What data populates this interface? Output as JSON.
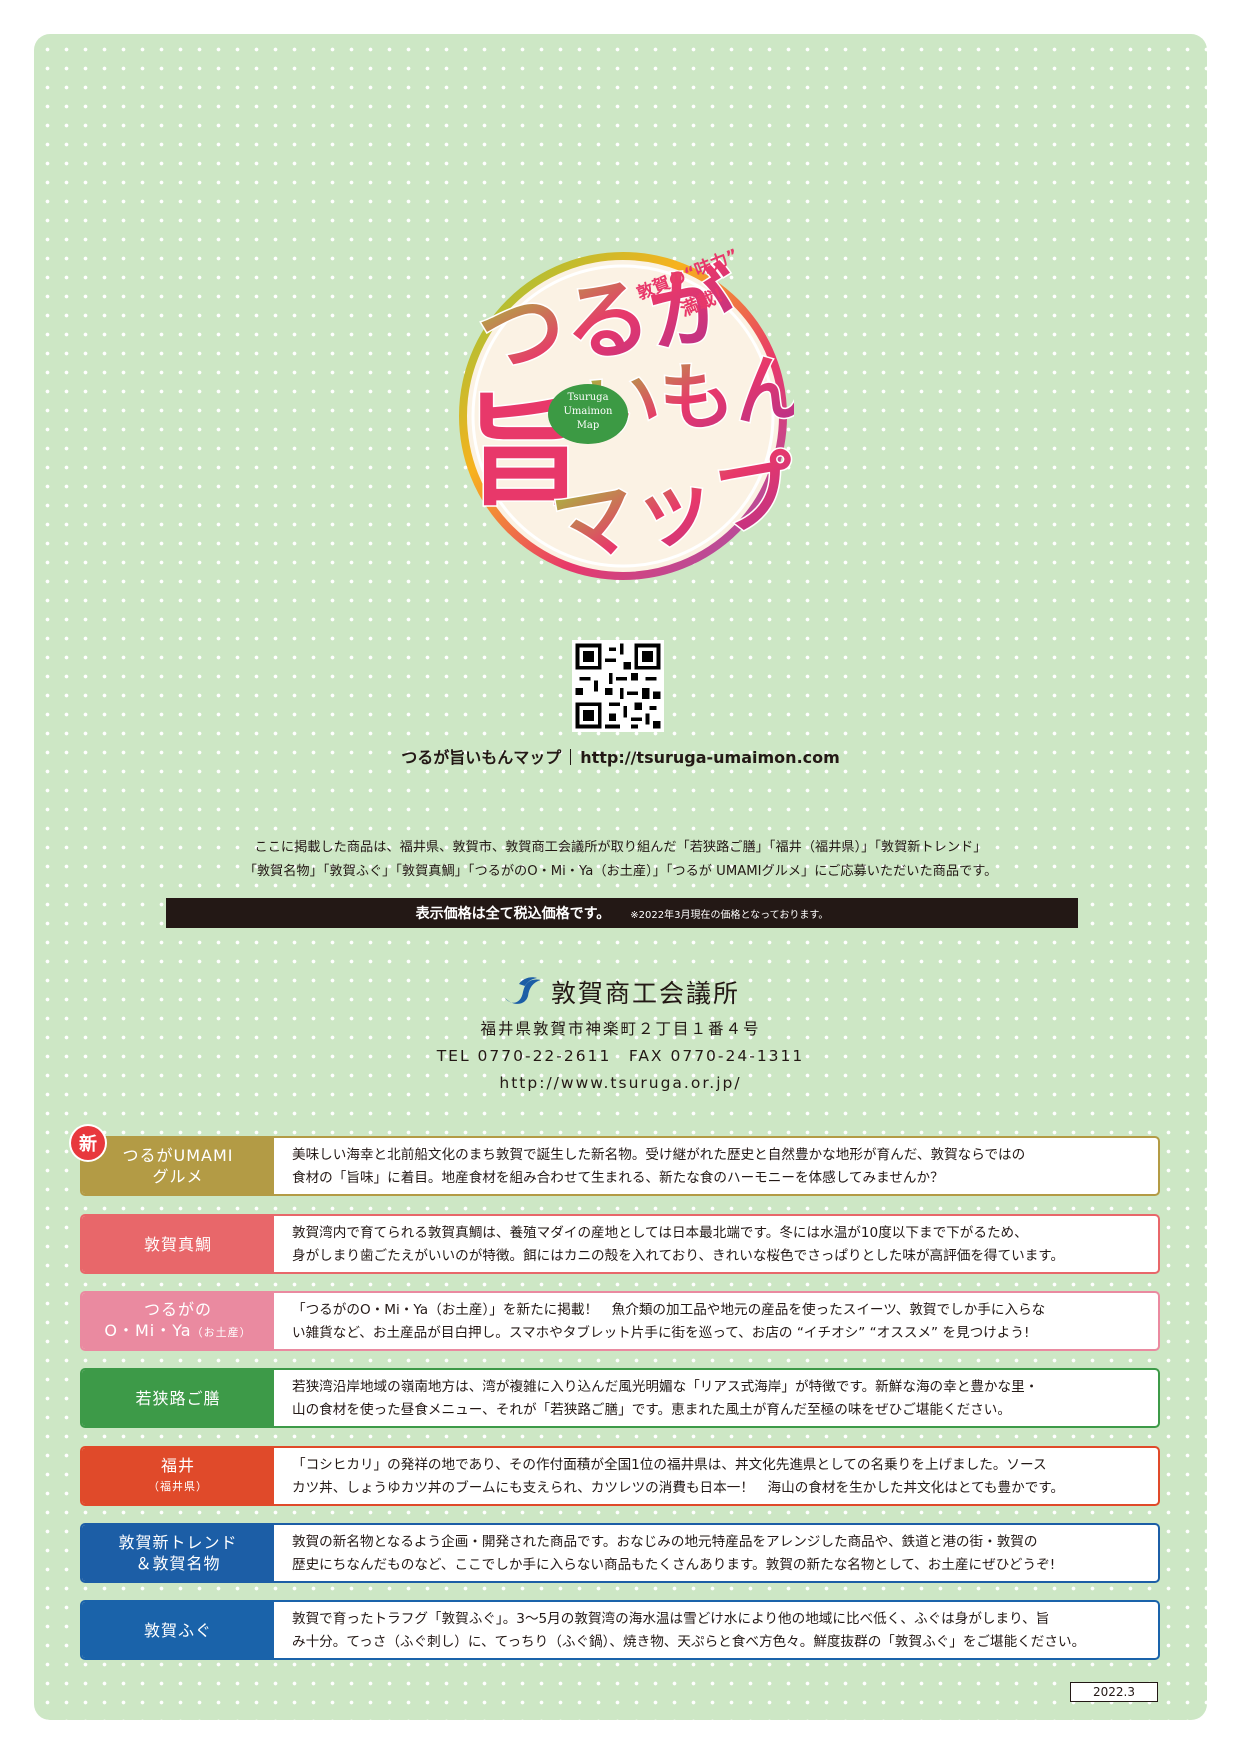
{
  "logo": {
    "title_line1": "つるが",
    "title_line2a": "旨",
    "title_line2b": "いもん",
    "title_line3": "マップ",
    "tagline_a": "敦賀の“味力”",
    "tagline_b": "満載！",
    "badge_line1": "Tsuruga",
    "badge_line2": "Umaimon",
    "badge_line3": "Map"
  },
  "website": {
    "name": "つるが旨いもんマップ",
    "url": "http://tsuruga-umaimon.com"
  },
  "intro": {
    "line1": "ここに掲載した商品は、福井県、敦賀市、敦賀商工会議所が取り組んだ「若狭路ご膳」「福井（福井県）」「敦賀新トレンド」",
    "line2": "「敦賀名物」「敦賀ふぐ」「敦賀真鯛」「つるがのO・Mi・Ya（お土産）」「つるが UMAMIグルメ」にご応募いただいた商品です。"
  },
  "tax_notice": {
    "main": "表示価格は全て税込価格です。",
    "note": "※2022年3月現在の価格となっております。"
  },
  "chamber": {
    "name": "敦賀商工会議所",
    "address": "福井県敦賀市神楽町２丁目１番４号",
    "tel_fax": "TEL 0770-22-2611　FAX 0770-24-1311",
    "url": "http://www.tsuruga.or.jp/"
  },
  "new_badge": "新",
  "categories": [
    {
      "label_line1": "つるがUMAMI",
      "label_line2": "グルメ",
      "label_small": "",
      "color": "#b39b45",
      "desc_line1": "美味しい海幸と北前船文化のまち敦賀で誕生した新名物。受け継がれた歴史と自然豊かな地形が育んだ、敦賀ならではの",
      "desc_line2": "食材の「旨味」に着目。地産食材を組み合わせて生まれる、新たな食のハーモニーを体感してみませんか？"
    },
    {
      "label_line1": "敦賀真鯛",
      "label_line2": "",
      "label_small": "",
      "color": "#e8676a",
      "desc_line1": "敦賀湾内で育てられる敦賀真鯛は、養殖マダイの産地としては日本最北端です。冬には水温が10度以下まで下がるため、",
      "desc_line2": "身がしまり歯ごたえがいいのが特徴。餌にはカニの殻を入れており、きれいな桜色でさっぱりとした味が高評価を得ています。"
    },
    {
      "label_line1": "つるがの",
      "label_line2": "O・Mi・Ya",
      "label_small": "（お土産）",
      "color": "#ea8aa0",
      "desc_line1": "「つるがのO・Mi・Ya（お土産）」を新たに掲載！　魚介類の加工品や地元の産品を使ったスイーツ、敦賀でしか手に入らな",
      "desc_line2": "い雑貨など、お土産品が目白押し。スマホやタブレット片手に街を巡って、お店の “イチオシ” “オススメ” を見つけよう!"
    },
    {
      "label_line1": "若狭路ご膳",
      "label_line2": "",
      "label_small": "",
      "color": "#3d9a48",
      "desc_line1": "若狭湾沿岸地域の嶺南地方は、湾が複雑に入り込んだ風光明媚な「リアス式海岸」が特徴です。新鮮な海の幸と豊かな里・",
      "desc_line2": "山の食材を使った昼食メニュー、それが「若狭路ご膳」です。恵まれた風土が育んだ至極の味をぜひご堪能ください。"
    },
    {
      "label_line1": "福井",
      "label_line2": "",
      "label_small": "（福井県）",
      "color": "#e04a2a",
      "desc_line1": "「コシヒカリ」の発祥の地であり、その作付面積が全国1位の福井県は、丼文化先進県としての名乗りを上げました。ソース",
      "desc_line2": "カツ丼、しょうゆカツ丼のブームにも支えられ、カツレツの消費も日本一！　海山の食材を生かした丼文化はとても豊かです。"
    },
    {
      "label_line1": "敦賀新トレンド",
      "label_line2": "＆敦賀名物",
      "label_small": "",
      "color": "#1c5ea6",
      "desc_line1": "敦賀の新名物となるよう企画・開発された商品です。おなじみの地元特産品をアレンジした商品や、鉄道と港の街・敦賀の",
      "desc_line2": "歴史にちなんだものなど、ここでしか手に入らない商品もたくさんあります。敦賀の新たな名物として、お土産にぜひどうぞ!"
    },
    {
      "label_line1": "敦賀ふぐ",
      "label_line2": "",
      "label_small": "",
      "color": "#1a63aa",
      "desc_line1": "敦賀で育ったトラフグ「敦賀ふぐ」。3～5月の敦賀湾の海水温は雪どけ水により他の地域に比べ低く、ふぐは身がしまり、旨",
      "desc_line2": "み十分。てっさ（ふぐ刺し）に、てっちり（ふぐ鍋）、焼き物、天ぷらと食べ方色々。鮮度抜群の「敦賀ふぐ」をご堪能ください。"
    }
  ],
  "date": "2022.3"
}
